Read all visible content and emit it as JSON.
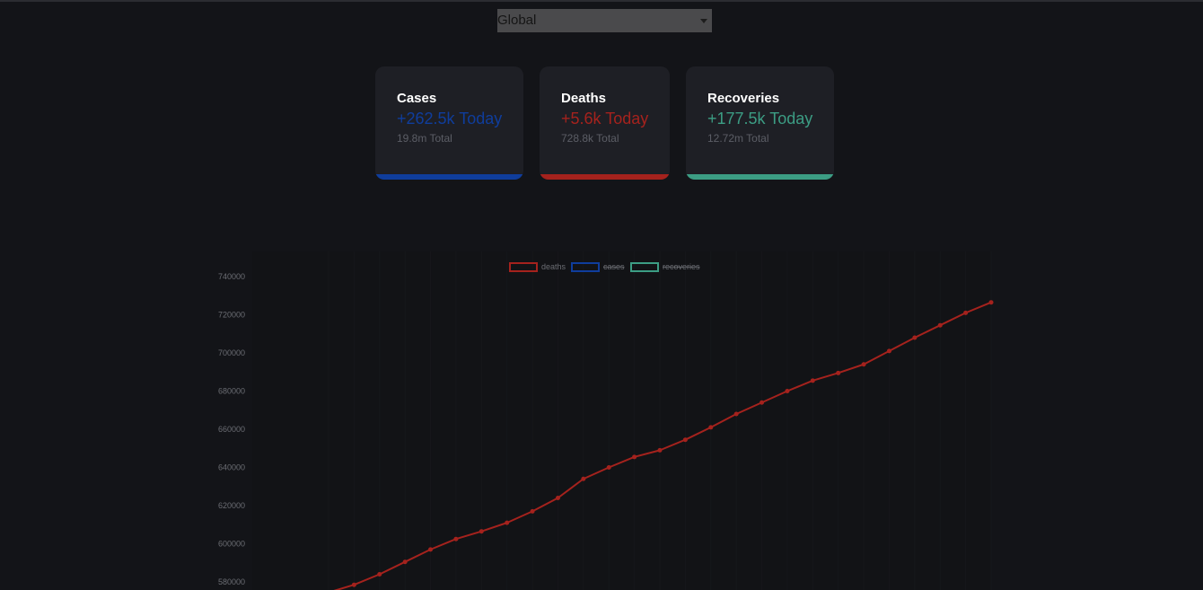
{
  "region_select": {
    "value": "Global",
    "icon": "chevron-down-icon"
  },
  "cards": [
    {
      "title": "Cases",
      "today": "+262.5k Today",
      "total": "19.8m Total",
      "color": "#0f3d9c"
    },
    {
      "title": "Deaths",
      "today": "+5.6k Today",
      "total": "728.8k Total",
      "color": "#a5221d"
    },
    {
      "title": "Recoveries",
      "today": "+177.5k Today",
      "total": "12.72m Total",
      "color": "#3c9d84"
    }
  ],
  "chart_data": {
    "type": "line",
    "series": [
      {
        "name": "deaths",
        "color": "#a5221d",
        "hidden": false,
        "values": [
          574500,
          578500,
          584000,
          590500,
          597000,
          602500,
          606500,
          611000,
          617000,
          624000,
          634000,
          640000,
          645500,
          649000,
          654500,
          661000,
          668000,
          674000,
          680000,
          685500,
          689500,
          694000,
          701000,
          708000,
          714500,
          721000,
          726500
        ]
      },
      {
        "name": "cases",
        "color": "#0f3d9c",
        "hidden": true,
        "values": []
      },
      {
        "name": "recoveries",
        "color": "#3c9d84",
        "hidden": true,
        "values": []
      }
    ],
    "y_ticks": [
      "740000",
      "720000",
      "700000",
      "680000",
      "660000",
      "640000",
      "620000",
      "600000",
      "580000"
    ],
    "ylim": [
      580000,
      740000
    ],
    "legend_position": "top-center",
    "grid": true
  }
}
